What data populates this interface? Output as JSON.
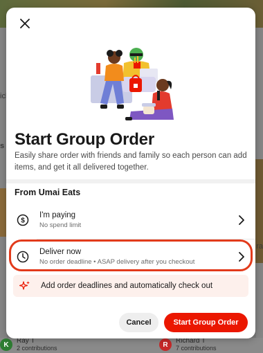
{
  "background": {
    "left_letters": [
      "ich",
      "s"
    ],
    "right_letters": [
      "ra"
    ],
    "contributors": [
      {
        "initial": "K",
        "name": "Ray T",
        "contributions": "2 contributions",
        "color": "#2e7d32"
      },
      {
        "initial": "R",
        "name": "Richard T",
        "contributions": "7 contributions",
        "color": "#c62828"
      }
    ]
  },
  "modal": {
    "title": "Start Group Order",
    "subtitle": "Easily share order with friends and family so each person can add items, and get it all delivered together.",
    "section_title": "From Umai Eats",
    "options": [
      {
        "title": "I'm paying",
        "subtitle": "No spend limit",
        "icon": "dollar-circle-icon"
      },
      {
        "title": "Deliver now",
        "subtitle": "No order deadline • ASAP delivery after you checkout",
        "icon": "clock-icon"
      }
    ],
    "banner": {
      "text": "Add order deadlines and automatically check out",
      "icon": "sparkle-icon"
    },
    "cancel_label": "Cancel",
    "primary_label": "Start Group Order"
  },
  "colors": {
    "accent": "#eb1700",
    "highlight": "#e23a1b",
    "banner_bg": "#fdf0ec"
  }
}
